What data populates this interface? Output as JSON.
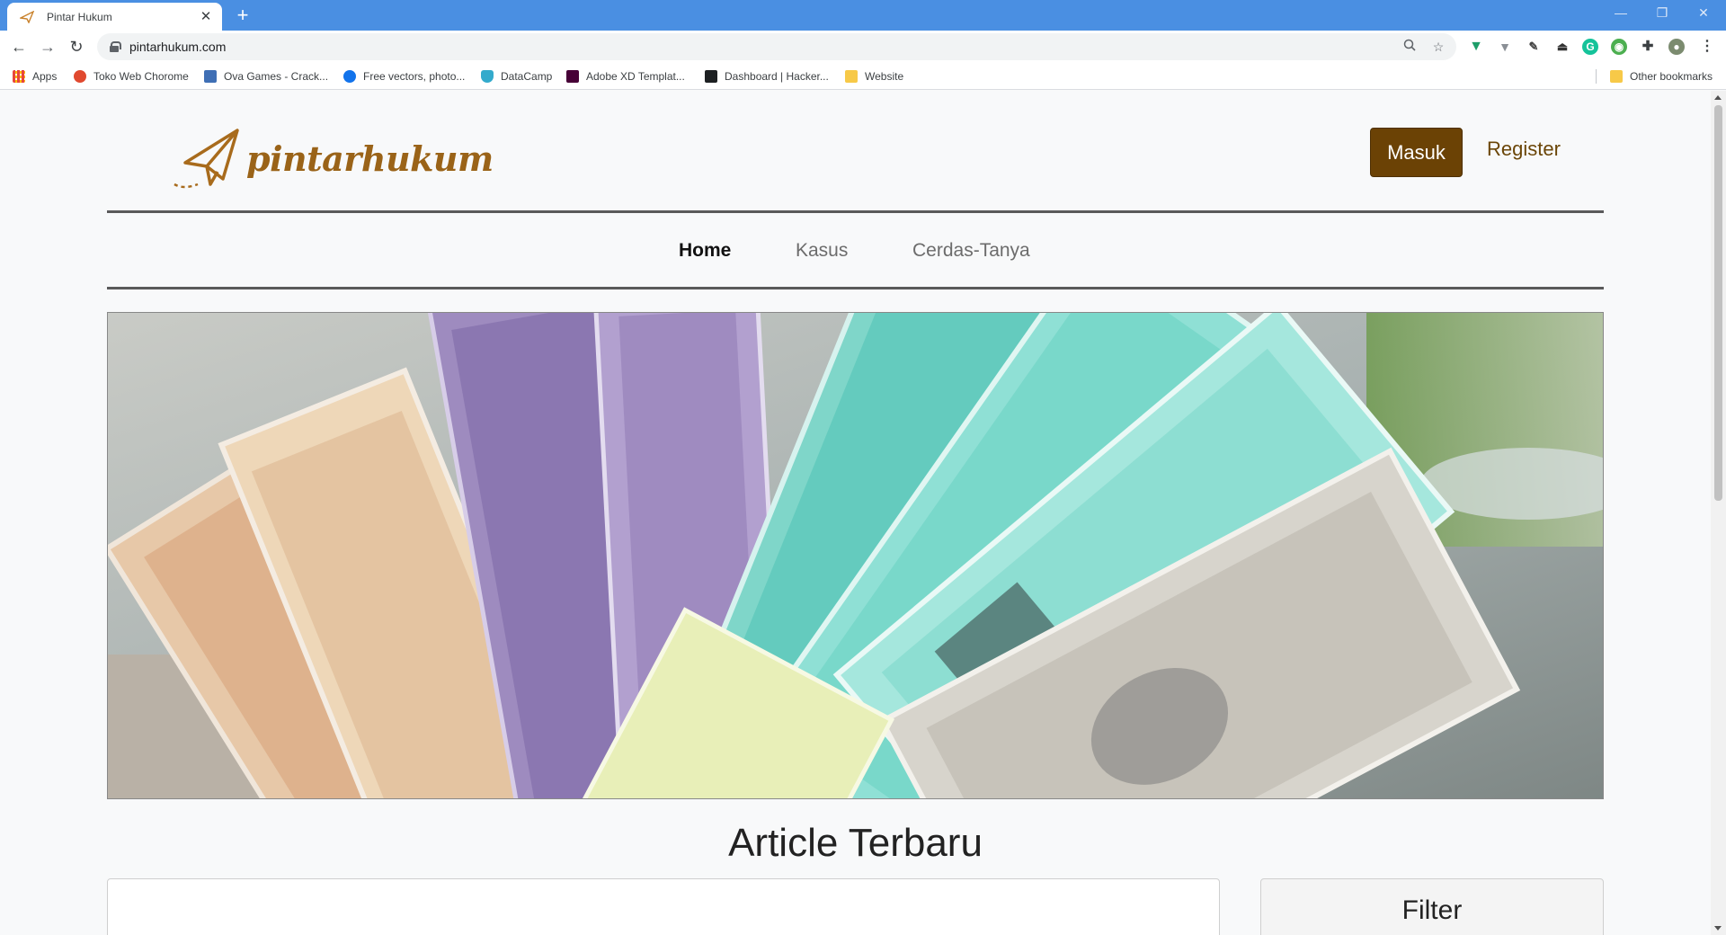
{
  "browser": {
    "tab_title": "Pintar Hukum",
    "url": "pintarhukum.com",
    "bookmarks": [
      {
        "label": "Apps",
        "icon": "apps-grid-icon",
        "color": "#e8453c"
      },
      {
        "label": "Toko Web Chorome",
        "icon": "chrome-store-icon",
        "color": "#e0492f"
      },
      {
        "label": "Ova Games - Crack...",
        "icon": "ova-games-icon",
        "color": "#3f6fb5"
      },
      {
        "label": "Free vectors, photo...",
        "icon": "freepik-icon",
        "color": "#1273eb"
      },
      {
        "label": "DataCamp",
        "icon": "datacamp-icon",
        "color": "#3ac"
      },
      {
        "label": "Adobe XD Templat...",
        "icon": "adobe-xd-icon",
        "color": "#470137"
      },
      {
        "label": "Dashboard | Hacker...",
        "icon": "hackerrank-icon",
        "color": "#1d2022"
      },
      {
        "label": "Website",
        "icon": "folder-icon",
        "color": "#f7c948"
      }
    ],
    "other_bookmarks": "Other bookmarks"
  },
  "site": {
    "logo_text": "pintarhukum",
    "login_label": "Masuk",
    "register_label": "Register",
    "nav": [
      "Home",
      "Kasus",
      "Cerdas-Tanya"
    ],
    "section_title": "Article Terbaru",
    "filter_title": "Filter"
  },
  "colors": {
    "brand": "#6b4205",
    "logo": "#9a6318",
    "chrome_tabbar": "#4a8fe2"
  }
}
